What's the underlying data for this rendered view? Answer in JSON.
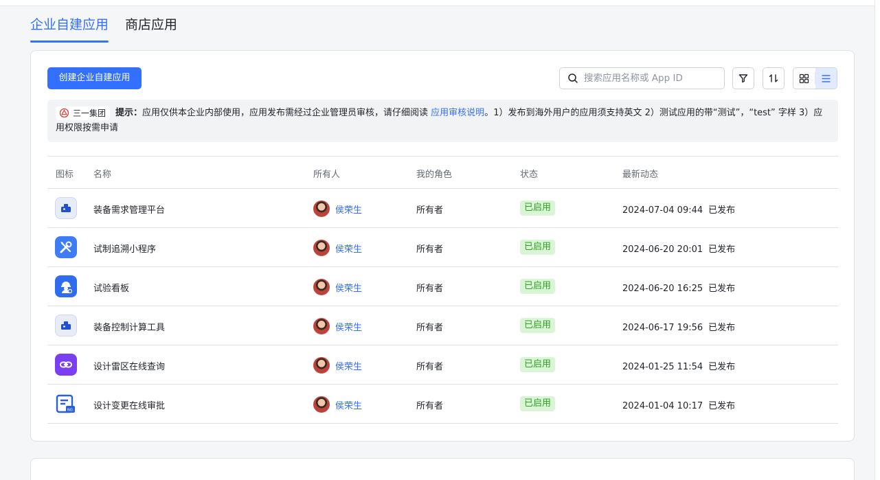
{
  "tabs": [
    {
      "label": "企业自建应用",
      "active": true
    },
    {
      "label": "商店应用",
      "active": false
    }
  ],
  "toolbar": {
    "create_label": "创建企业自建应用",
    "search_placeholder": "搜索应用名称或 App ID"
  },
  "notice": {
    "org": "三一集团",
    "prefix": "提示：",
    "text1": "应用仅供本企业内部使用，应用发布需经过企业管理员审核，请仔细阅读 ",
    "link": "应用审核说明",
    "text2": "。1）发布到海外用户的应用须支持英文 2）测试应用的带“测试”，“test” 字样 3）应用权限按需申请"
  },
  "table": {
    "headers": {
      "icon": "图标",
      "name": "名称",
      "owner": "所有人",
      "role": "我的角色",
      "status": "状态",
      "activity": "最新动态"
    },
    "rows": [
      {
        "icon": "briefcase-icon",
        "name": "装备需求管理平台",
        "owner": "侯荣生",
        "role": "所有者",
        "status": "已启用",
        "time": "2024-07-04 09:44",
        "state": "已发布"
      },
      {
        "icon": "tools-icon",
        "name": "试制追溯小程序",
        "owner": "侯荣生",
        "role": "所有者",
        "status": "已启用",
        "time": "2024-06-20 20:01",
        "state": "已发布"
      },
      {
        "icon": "worker-icon",
        "name": "试验看板",
        "owner": "侯荣生",
        "role": "所有者",
        "status": "已启用",
        "time": "2024-06-20 16:25",
        "state": "已发布"
      },
      {
        "icon": "briefcase-icon",
        "name": "装备控制计算工具",
        "owner": "侯荣生",
        "role": "所有者",
        "status": "已启用",
        "time": "2024-06-17 19:56",
        "state": "已发布"
      },
      {
        "icon": "link-icon",
        "name": "设计雷区在线查询",
        "owner": "侯荣生",
        "role": "所有者",
        "status": "已启用",
        "time": "2024-01-25 11:54",
        "state": "已发布"
      },
      {
        "icon": "document-icon",
        "name": "设计变更在线审批",
        "owner": "侯荣生",
        "role": "所有者",
        "status": "已启用",
        "time": "2024-01-04 10:17",
        "state": "已发布"
      }
    ]
  },
  "colors": {
    "accent": "#3370ff",
    "status_bg": "#d9f5d6",
    "status_text": "#2ea121",
    "purple": "#7b3ff2"
  }
}
